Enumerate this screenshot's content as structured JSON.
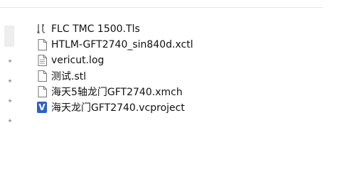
{
  "files": [
    {
      "name": "FLC TMC 1500.Tls",
      "icon": "tool-icon"
    },
    {
      "name": "HTLM-GFT2740_sin840d.xctl",
      "icon": "file-icon"
    },
    {
      "name": "vericut.log",
      "icon": "log-file-icon"
    },
    {
      "name": "测试.stl",
      "icon": "file-icon"
    },
    {
      "name": "海天5轴龙门GFT2740.xmch",
      "icon": "file-icon"
    },
    {
      "name": "海天龙门GFT2740.vcproject",
      "icon": "vericut-project-icon"
    }
  ],
  "vericut_icon_letter": "V",
  "colors": {
    "vericut_blue": "#2a62c9",
    "text": "#111111"
  }
}
